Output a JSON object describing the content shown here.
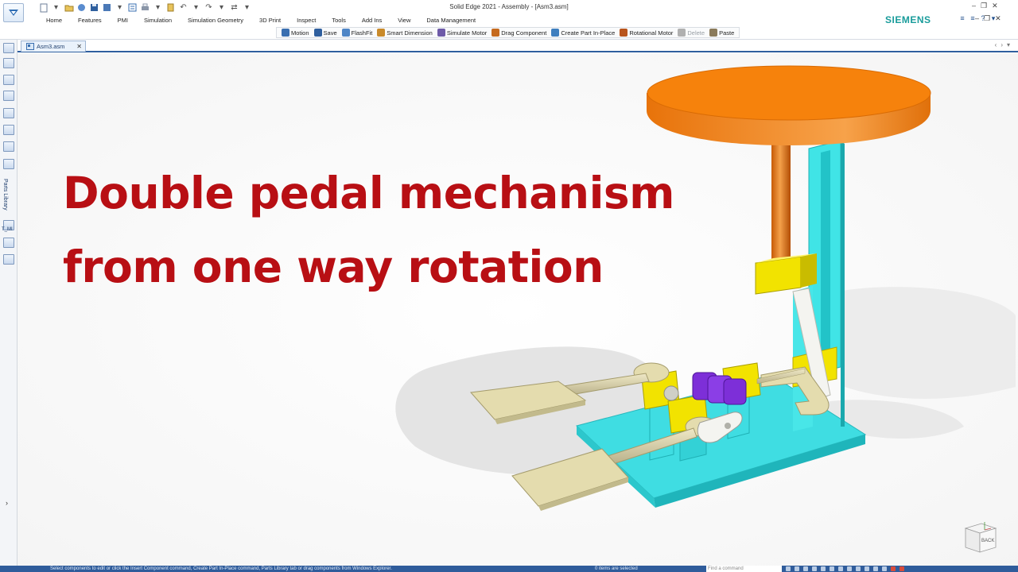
{
  "window": {
    "title": "Solid Edge 2021 - Assembly - [Asm3.asm]",
    "brand": "SIEMENS"
  },
  "ribbon": {
    "tabs": [
      "Home",
      "Features",
      "PMI",
      "Simulation",
      "Simulation Geometry",
      "3D Print",
      "Inspect",
      "Tools",
      "Add Ins",
      "View",
      "Data Management"
    ],
    "commands": [
      {
        "label": "Motion",
        "icon": "motion-icon",
        "color": "#3a6fb0",
        "enabled": true
      },
      {
        "label": "Save",
        "icon": "save-icon",
        "color": "#2f5f9e",
        "enabled": true
      },
      {
        "label": "FlashFit",
        "icon": "flashfit-icon",
        "color": "#4f86c6",
        "enabled": true
      },
      {
        "label": "Smart Dimension",
        "icon": "smart-dimension-icon",
        "color": "#c98a2a",
        "enabled": true
      },
      {
        "label": "Simulate Motor",
        "icon": "simulate-motor-icon",
        "color": "#6d5aa8",
        "enabled": true
      },
      {
        "label": "Drag Component",
        "icon": "drag-component-icon",
        "color": "#c56a1f",
        "enabled": true
      },
      {
        "label": "Create Part In-Place",
        "icon": "create-part-icon",
        "color": "#3f7fbf",
        "enabled": true
      },
      {
        "label": "Rotational Motor",
        "icon": "rotational-motor-icon",
        "color": "#b8541c",
        "enabled": true
      },
      {
        "label": "Delete",
        "icon": "delete-icon",
        "color": "#b0b0b0",
        "enabled": false
      },
      {
        "label": "Paste",
        "icon": "paste-icon",
        "color": "#8a7a5a",
        "enabled": true
      }
    ]
  },
  "document": {
    "tab_label": "Asm3.asm"
  },
  "leftbar": {
    "parts_library_label": "Parts Library",
    "panel_label": "T_MI",
    "panel_number": "2"
  },
  "viewport": {
    "headline_line1": "Double pedal mechanism",
    "headline_line2": "from one way rotation",
    "viewcube_label": "BACK"
  },
  "statusbar": {
    "prompt": "Select components to edit or click the Insert Component command, Create Part In-Place command, Parts Library tab or drag components from Windows Explorer.",
    "selection_count": "0 items are selected",
    "find_placeholder": "Find a command"
  },
  "colors": {
    "headline": "#b80f14",
    "brand": "#199c9b",
    "statusbar": "#2f5c9b",
    "seat": "#f6820c",
    "frame": "#40e4e6",
    "blocks": "#f2e300",
    "gears": "#7d2fd8",
    "pedals": "#e4dcae"
  }
}
